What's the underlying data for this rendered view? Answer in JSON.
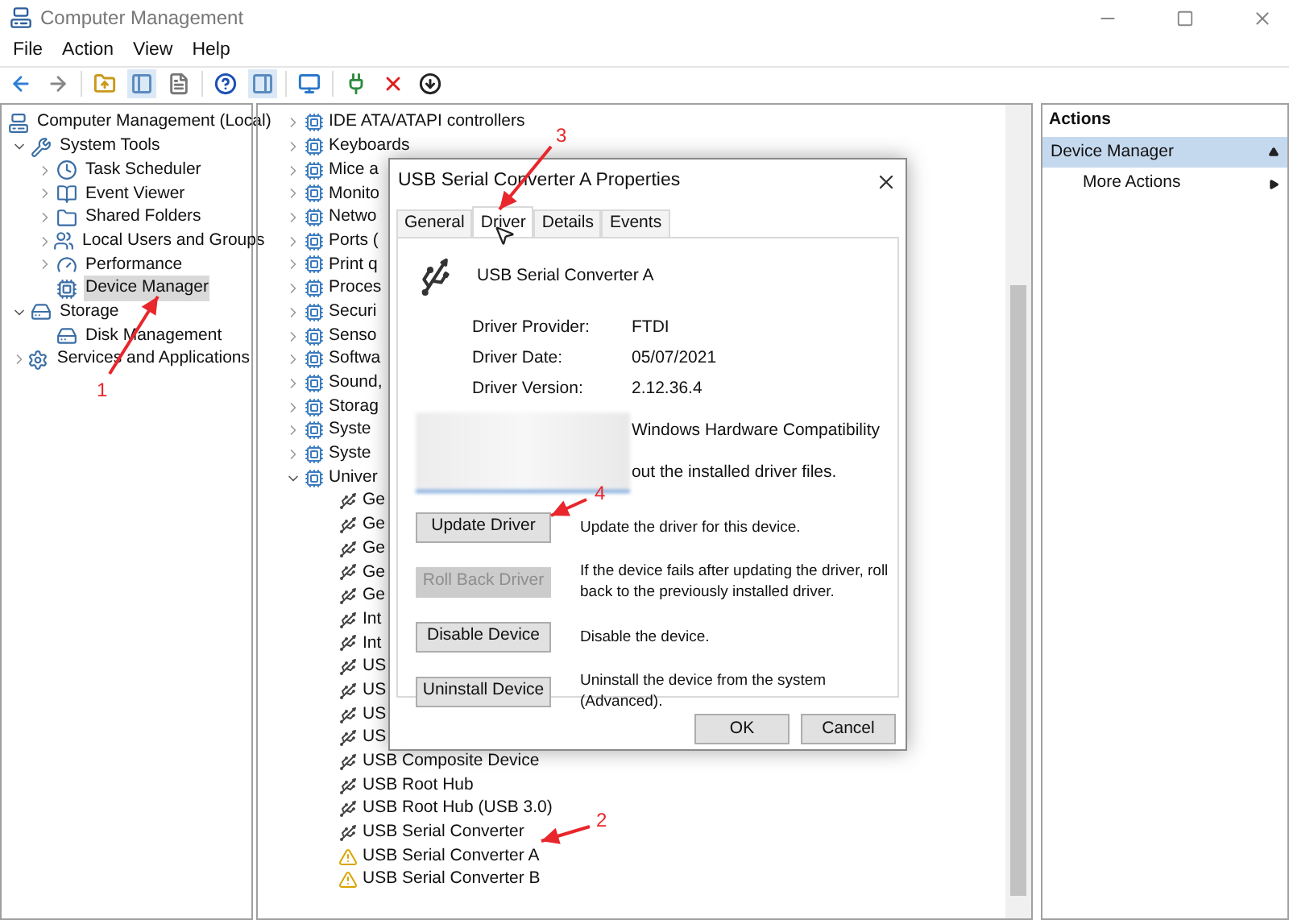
{
  "window": {
    "title": "Computer Management"
  },
  "menu": [
    "File",
    "Action",
    "View",
    "Help"
  ],
  "tree": [
    {
      "label": "Computer Management (Local)",
      "selected": false,
      "children": [
        {
          "label": "System Tools",
          "selected": false,
          "expanded": true,
          "children": [
            {
              "label": "Task Scheduler",
              "selected": false,
              "expanded": false
            },
            {
              "label": "Event Viewer",
              "selected": false,
              "expanded": false
            },
            {
              "label": "Shared Folders",
              "selected": false,
              "expanded": false
            },
            {
              "label": "Local Users and Groups",
              "selected": false,
              "expanded": false
            },
            {
              "label": "Performance",
              "selected": false,
              "expanded": false
            },
            {
              "label": "Device Manager",
              "selected": true
            }
          ]
        },
        {
          "label": "Storage",
          "selected": false,
          "expanded": true,
          "children": [
            {
              "label": "Disk Management",
              "selected": false
            }
          ]
        },
        {
          "label": "Services and Applications",
          "selected": false,
          "expanded": false
        }
      ]
    }
  ],
  "devices": [
    {
      "label": "IDE ATA/ATAPI controllers",
      "expanded": false
    },
    {
      "label": "Keyboards",
      "expanded": false
    },
    {
      "label": "Mice a",
      "expanded": false
    },
    {
      "label": "Monito",
      "expanded": false
    },
    {
      "label": "Netwo",
      "expanded": false
    },
    {
      "label": "Ports (",
      "expanded": false
    },
    {
      "label": "Print q",
      "expanded": false
    },
    {
      "label": "Proces",
      "expanded": false
    },
    {
      "label": "Securi",
      "expanded": false
    },
    {
      "label": "Senso",
      "expanded": false
    },
    {
      "label": "Softwa",
      "expanded": false
    },
    {
      "label": "Sound,",
      "expanded": false
    },
    {
      "label": "Storag",
      "expanded": false
    },
    {
      "label": "Syste",
      "expanded": false
    },
    {
      "label": "Syste",
      "expanded": false
    },
    {
      "label": "Univer",
      "expanded": true,
      "children": [
        {
          "label": "Ge",
          "warning": false
        },
        {
          "label": "Ge",
          "warning": false
        },
        {
          "label": "Ge",
          "warning": false
        },
        {
          "label": "Ge",
          "warning": false
        },
        {
          "label": "Ge",
          "warning": false
        },
        {
          "label": "Int",
          "warning": false
        },
        {
          "label": "Int",
          "warning": false
        },
        {
          "label": "US",
          "warning": false
        },
        {
          "label": "US",
          "warning": false
        },
        {
          "label": "US",
          "warning": false
        },
        {
          "label": "US",
          "warning": false
        },
        {
          "label": "USB Composite Device",
          "warning": false
        },
        {
          "label": "USB Root Hub",
          "warning": false
        },
        {
          "label": "USB Root Hub (USB 3.0)",
          "warning": false
        },
        {
          "label": "USB Serial Converter",
          "warning": false
        },
        {
          "label": "USB Serial Converter A",
          "warning": true
        },
        {
          "label": "USB Serial Converter B",
          "warning": true
        }
      ]
    }
  ],
  "actions": {
    "title": "Actions",
    "section": "Device Manager",
    "items": [
      "More Actions"
    ]
  },
  "dialog": {
    "title": "USB Serial Converter A Properties",
    "tabs": [
      {
        "label": "General",
        "selected": false
      },
      {
        "label": "Driver",
        "selected": true
      },
      {
        "label": "Details",
        "selected": false
      },
      {
        "label": "Events",
        "selected": false
      }
    ],
    "device_name": "USB Serial Converter A",
    "fields": [
      {
        "label": "Driver Provider:",
        "value": "FTDI"
      },
      {
        "label": "Driver Date:",
        "value": "05/07/2021"
      },
      {
        "label": "Driver Version:",
        "value": "2.12.36.4"
      }
    ],
    "partial_lines": [
      "Windows Hardware Compatibility",
      "out the installed driver files."
    ],
    "buttons": [
      {
        "label": "Update Driver",
        "disabled": false,
        "description": "Update the driver for this device."
      },
      {
        "label": "Roll Back Driver",
        "disabled": true,
        "description": "If the device fails after updating the driver, roll back to the previously installed driver."
      },
      {
        "label": "Disable Device",
        "disabled": false,
        "description": "Disable the device."
      },
      {
        "label": "Uninstall Device",
        "disabled": false,
        "description": "Uninstall the device from the system (Advanced)."
      }
    ],
    "footer": [
      "OK",
      "Cancel"
    ]
  },
  "annotations": [
    {
      "label": "1"
    },
    {
      "label": "2"
    },
    {
      "label": "3"
    },
    {
      "label": "4"
    }
  ]
}
